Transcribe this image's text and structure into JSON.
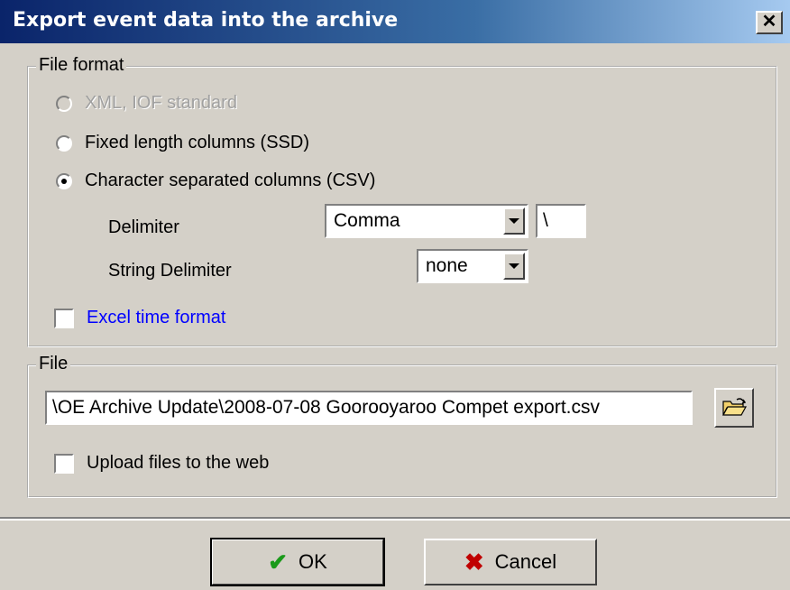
{
  "window": {
    "title": "Export event data into the archive",
    "close_label": "✕"
  },
  "file_format": {
    "legend": "File format",
    "options": [
      {
        "label": "XML, IOF standard",
        "checked": false,
        "disabled": true
      },
      {
        "label": "Fixed length columns (SSD)",
        "checked": false,
        "disabled": false
      },
      {
        "label": "Character separated columns (CSV)",
        "checked": true,
        "disabled": false
      }
    ],
    "delimiter_label": "Delimiter",
    "delimiter_value": "Comma",
    "delimiter_char": "\\",
    "string_delimiter_label": "String Delimiter",
    "string_delimiter_value": "none",
    "excel_time_label": "Excel time format"
  },
  "file": {
    "legend": "File",
    "path": "\\OE Archive Update\\2008-07-08 Goorooyaroo Compet export.csv",
    "upload_label": "Upload files to the web"
  },
  "buttons": {
    "ok_label": "OK",
    "cancel_label": "Cancel"
  },
  "colors": {
    "title_start": "#0a246a",
    "face": "#d4d0c8",
    "link_blue": "#0000ff",
    "ok_check": "#1a9a1a",
    "cancel_x": "#c00000"
  },
  "icons": {
    "ok": "check-icon",
    "cancel": "x-icon",
    "browse": "folder-open-icon"
  }
}
